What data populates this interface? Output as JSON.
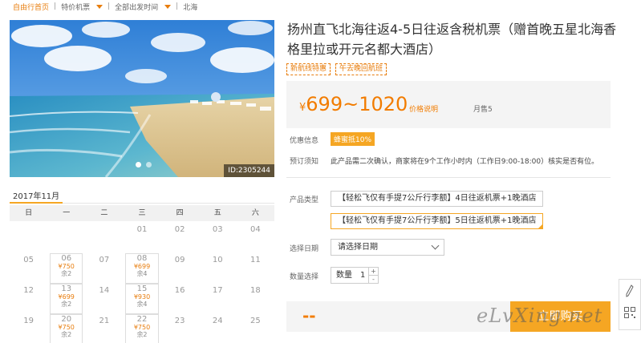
{
  "breadcrumb": {
    "home": "自由行首页",
    "category": "特价机票",
    "departure": "全部出发时间",
    "destination": "北海"
  },
  "photo": {
    "id_label": "ID:2305244"
  },
  "product": {
    "title": "扬州直飞北海往返4-5日往返含税机票（赠首晚五星北海香格里拉或开元名都大酒店）",
    "tags": [
      "新航线特惠",
      "午去晚回航班"
    ]
  },
  "price": {
    "currency": "¥",
    "range": "699~1020",
    "explain_link": "价格说明",
    "monthly_sales": "月售5"
  },
  "promo": {
    "label": "优惠信息",
    "badge": "蜂蜜抵10%"
  },
  "booking_notice": {
    "label": "预订须知",
    "text": "此产品需二次确认，商家将在9个工作小时内（工作日9:00-18:00）核实是否有位。"
  },
  "product_type": {
    "label": "产品类型",
    "options": [
      "【轻松飞仅有手提7公斤行李额】4日往返机票+1晚酒店",
      "【轻松飞仅有手提7公斤行李额】5日往返机票+1晚酒店"
    ],
    "selected_index": 1
  },
  "date_select": {
    "label": "选择日期",
    "placeholder": "请选择日期"
  },
  "quantity": {
    "label": "数量选择",
    "prefix": "数量",
    "value": "1",
    "plus": "+",
    "minus": "-"
  },
  "buy": {
    "total": "--",
    "button": "立即购买"
  },
  "watermark": "eLvXing.net",
  "calendar": {
    "month": "2017年11月",
    "weekdays": [
      "日",
      "一",
      "二",
      "三",
      "四",
      "五",
      "六"
    ],
    "rows": [
      [
        {
          "day": ""
        },
        {
          "day": ""
        },
        {
          "day": ""
        },
        {
          "day": "01"
        },
        {
          "day": "02"
        },
        {
          "day": "03"
        },
        {
          "day": "04"
        }
      ],
      [
        {
          "day": "05"
        },
        {
          "day": "06",
          "price": "¥750",
          "remain": "余2"
        },
        {
          "day": "07"
        },
        {
          "day": "08",
          "price": "¥699",
          "remain": "余4"
        },
        {
          "day": "09"
        },
        {
          "day": "10"
        },
        {
          "day": "11"
        }
      ],
      [
        {
          "day": "12"
        },
        {
          "day": "13",
          "price": "¥699",
          "remain": "余2"
        },
        {
          "day": "14"
        },
        {
          "day": "15",
          "price": "¥930",
          "remain": "余4"
        },
        {
          "day": "16"
        },
        {
          "day": "17"
        },
        {
          "day": "18"
        }
      ],
      [
        {
          "day": "19"
        },
        {
          "day": "20",
          "price": "¥750",
          "remain": "余2"
        },
        {
          "day": "21"
        },
        {
          "day": "22",
          "price": "¥750",
          "remain": "余2"
        },
        {
          "day": "23"
        },
        {
          "day": "24"
        },
        {
          "day": "25"
        }
      ]
    ]
  },
  "colors": {
    "accent": "#f27c00",
    "badge": "#f5a623"
  }
}
